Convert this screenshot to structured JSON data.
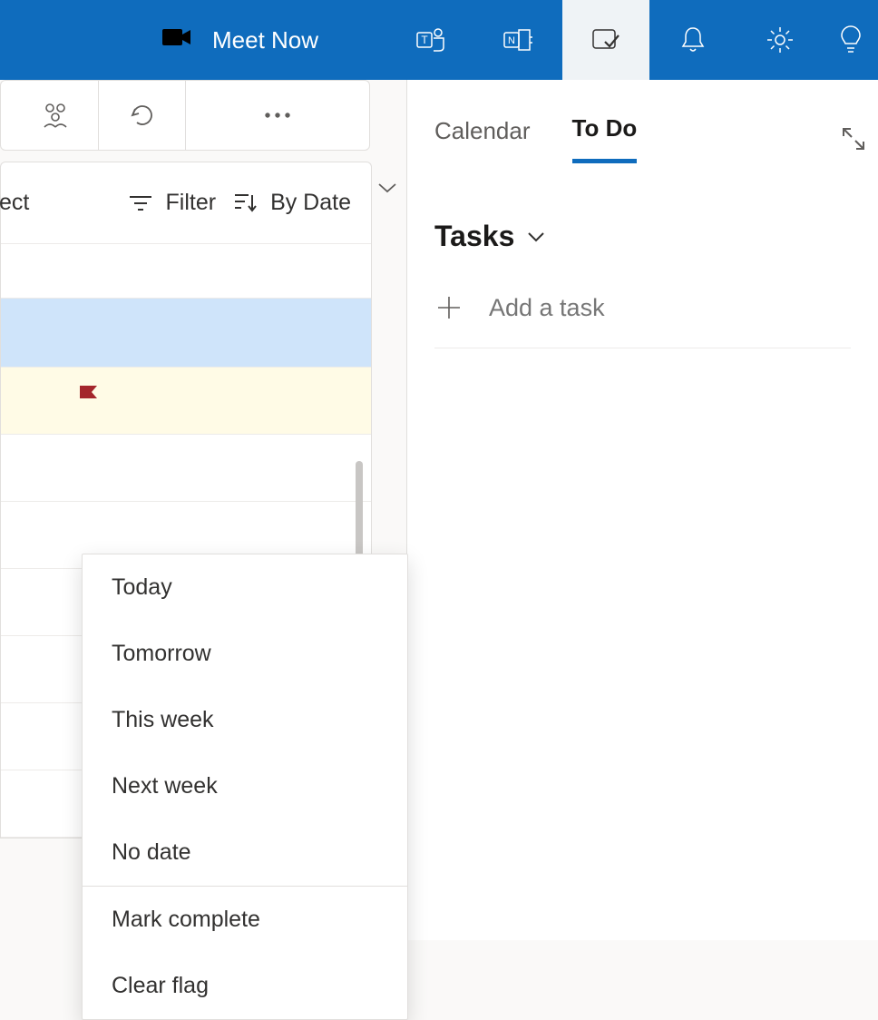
{
  "topbar": {
    "meet_now_label": "Meet Now"
  },
  "toolbar_left": {
    "select_fragment": "ect",
    "filter_label": "Filter",
    "sort_label": "By Date"
  },
  "context_menu": {
    "items": [
      "Today",
      "Tomorrow",
      "This week",
      "Next week",
      "No date"
    ],
    "items2": [
      "Mark complete",
      "Clear flag"
    ]
  },
  "right_panel": {
    "tab_calendar": "Calendar",
    "tab_todo": "To Do",
    "tasks_header": "Tasks",
    "add_task_placeholder": "Add a task"
  }
}
